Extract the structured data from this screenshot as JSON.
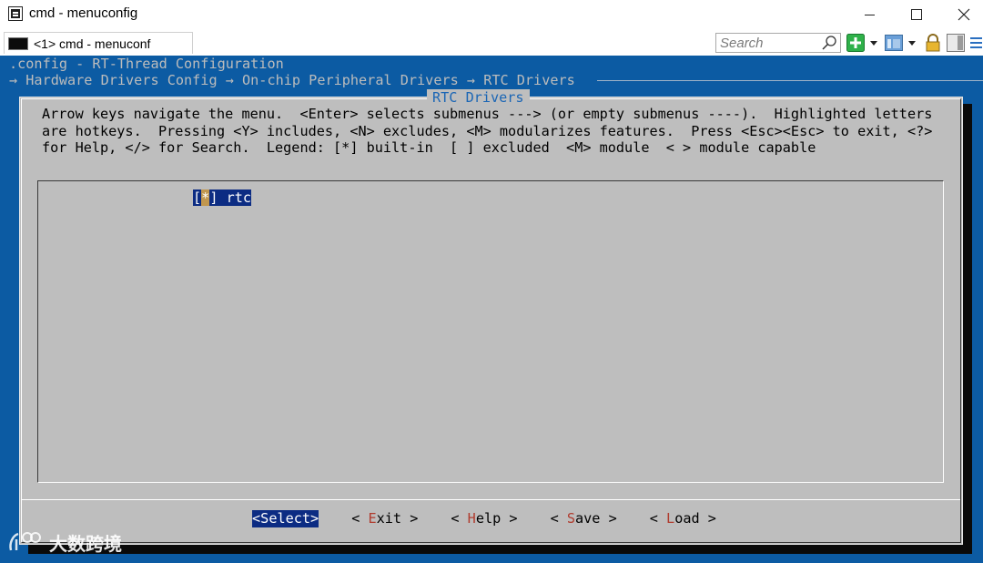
{
  "window": {
    "title": "cmd - menuconfig"
  },
  "toolbar": {
    "tab_label": "<1> cmd - menuconf",
    "search_placeholder": "Search"
  },
  "console": {
    "config_line": ".config - RT-Thread Configuration",
    "breadcrumb": "→ Hardware Drivers Config → On-chip Peripheral Drivers → RTC Drivers ",
    "dialog_title": "RTC Drivers",
    "help_lines": [
      "Arrow keys navigate the menu.  <Enter> selects submenus ---> (or empty submenus ----).  Highlighted letters",
      "are hotkeys.  Pressing <Y> includes, <N> excludes, <M> modularizes features.  Press <Esc><Esc> to exit, <?>",
      "for Help, </> for Search.  Legend: [*] built-in  [ ] excluded  <M> module  < > module capable"
    ],
    "menu_items": [
      {
        "bracket_open": "[",
        "state": "*",
        "bracket_close": "]",
        "label": " rtc"
      }
    ],
    "buttons": [
      {
        "pre": "<",
        "key": "S",
        "rest": "elect",
        "post": ">"
      },
      {
        "pre": "< ",
        "key": "E",
        "rest": "xit",
        "post": " >"
      },
      {
        "pre": "< ",
        "key": "H",
        "rest": "elp",
        "post": " >"
      },
      {
        "pre": "< ",
        "key": "S",
        "rest": "ave",
        "post": " >"
      },
      {
        "pre": "< ",
        "key": "L",
        "rest": "oad",
        "post": " >"
      }
    ]
  },
  "watermark": {
    "text": "大数跨境"
  },
  "colors": {
    "console_bg": "#0c5ba3",
    "dialog_bg": "#bebebe",
    "highlight_bg": "#0c2c83",
    "hotkey": "#b03b2e",
    "title_fg": "#1b66b5"
  },
  "icons": [
    "cmd-app-icon",
    "console-tab-icon",
    "search-icon",
    "new-console-icon",
    "view-icon",
    "lock-icon",
    "panel-icon",
    "menu-icon"
  ]
}
